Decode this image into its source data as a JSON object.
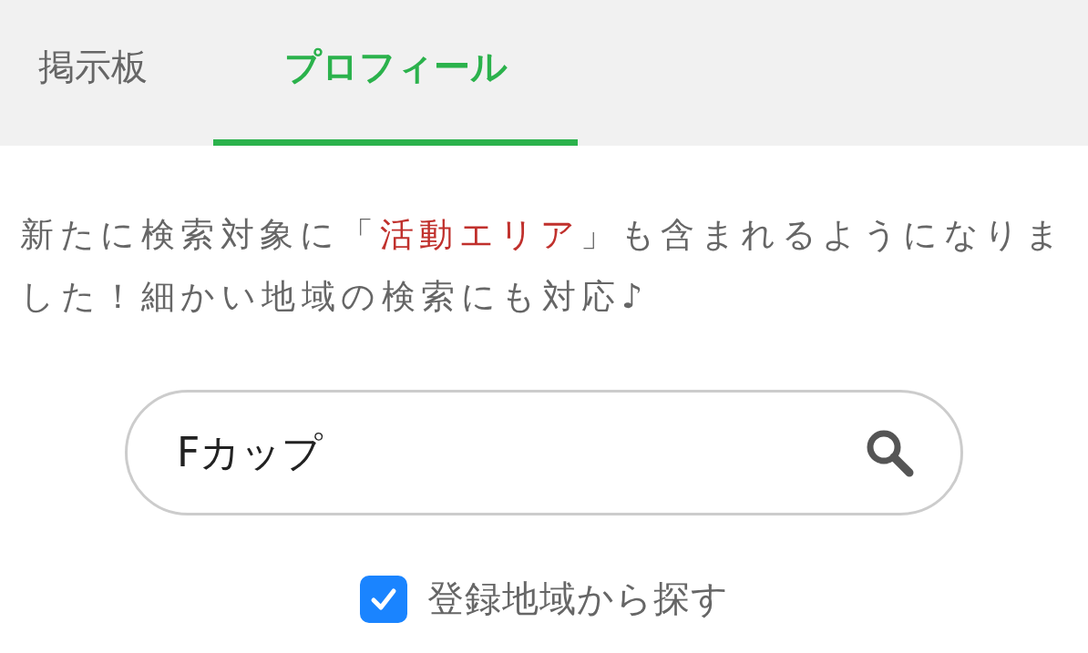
{
  "tabs": [
    {
      "label": "掲示板",
      "selected": false
    },
    {
      "label": "プロフィール",
      "selected": true
    }
  ],
  "notice": {
    "parts": [
      {
        "kind": "plain",
        "text": "新たに検索対象に「"
      },
      {
        "kind": "highlight",
        "text": "活動エリア"
      },
      {
        "kind": "plain",
        "text": "」も含まれるようになりました！細かい地域の検索にも対応♪"
      }
    ]
  },
  "search": {
    "value": "Fカップ"
  },
  "region_filter": {
    "label": "登録地域から探す",
    "checked": true
  }
}
